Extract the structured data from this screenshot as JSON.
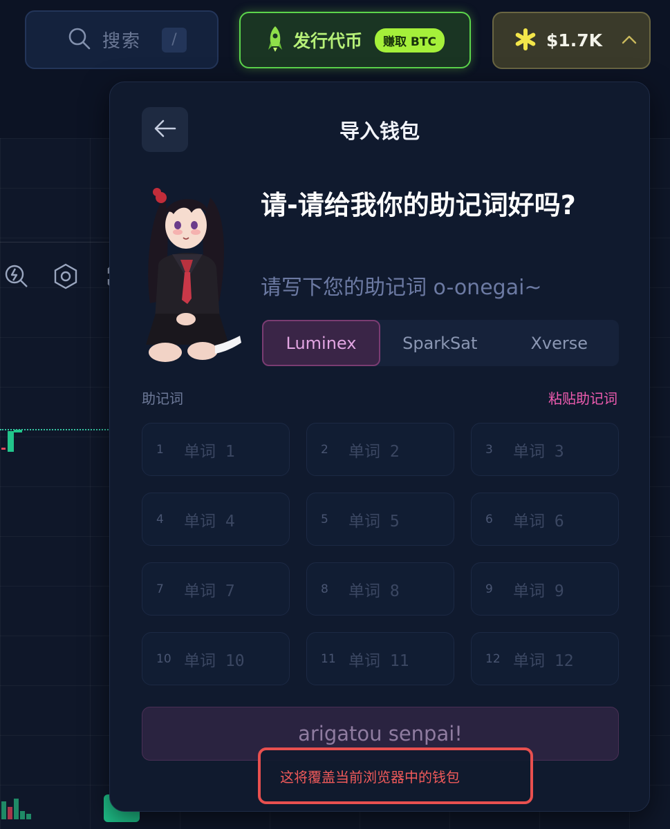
{
  "header": {
    "search_label": "搜索",
    "search_shortcut": "/",
    "launch_label": "发行代币",
    "launch_badge": "赚取 BTC",
    "balance_amount": "$1.7K"
  },
  "modal": {
    "title": "导入钱包",
    "headline": "请-请给我你的助记词好吗?",
    "subline": "请写下您的助记词 o-onegai~",
    "wallet_tabs": [
      {
        "label": "Luminex",
        "active": true
      },
      {
        "label": "SparkSat",
        "active": false
      },
      {
        "label": "Xverse",
        "active": false
      }
    ],
    "phrase_label": "助记词",
    "paste_label": "粘贴助记词",
    "words": [
      {
        "index": "1",
        "placeholder": "单词 1"
      },
      {
        "index": "2",
        "placeholder": "单词 2"
      },
      {
        "index": "3",
        "placeholder": "单词 3"
      },
      {
        "index": "4",
        "placeholder": "单词 4"
      },
      {
        "index": "5",
        "placeholder": "单词 5"
      },
      {
        "index": "6",
        "placeholder": "单词 6"
      },
      {
        "index": "7",
        "placeholder": "单词 7"
      },
      {
        "index": "8",
        "placeholder": "单词 8"
      },
      {
        "index": "9",
        "placeholder": "单词 9"
      },
      {
        "index": "10",
        "placeholder": "单词 10"
      },
      {
        "index": "11",
        "placeholder": "单词 11"
      },
      {
        "index": "12",
        "placeholder": "单词 12"
      }
    ],
    "submit_label": "arigatou senpai!",
    "warning": "这将覆盖当前浏览器中的钱包"
  },
  "colors": {
    "accent_pink": "#ef5cb0",
    "launch_green": "#a5f03a",
    "warning_red": "#f05a5a"
  },
  "icons": {
    "search": "search-icon",
    "rocket": "rocket-icon",
    "star": "star-icon",
    "chevron": "chevron-up-icon",
    "back": "arrow-left-icon"
  }
}
